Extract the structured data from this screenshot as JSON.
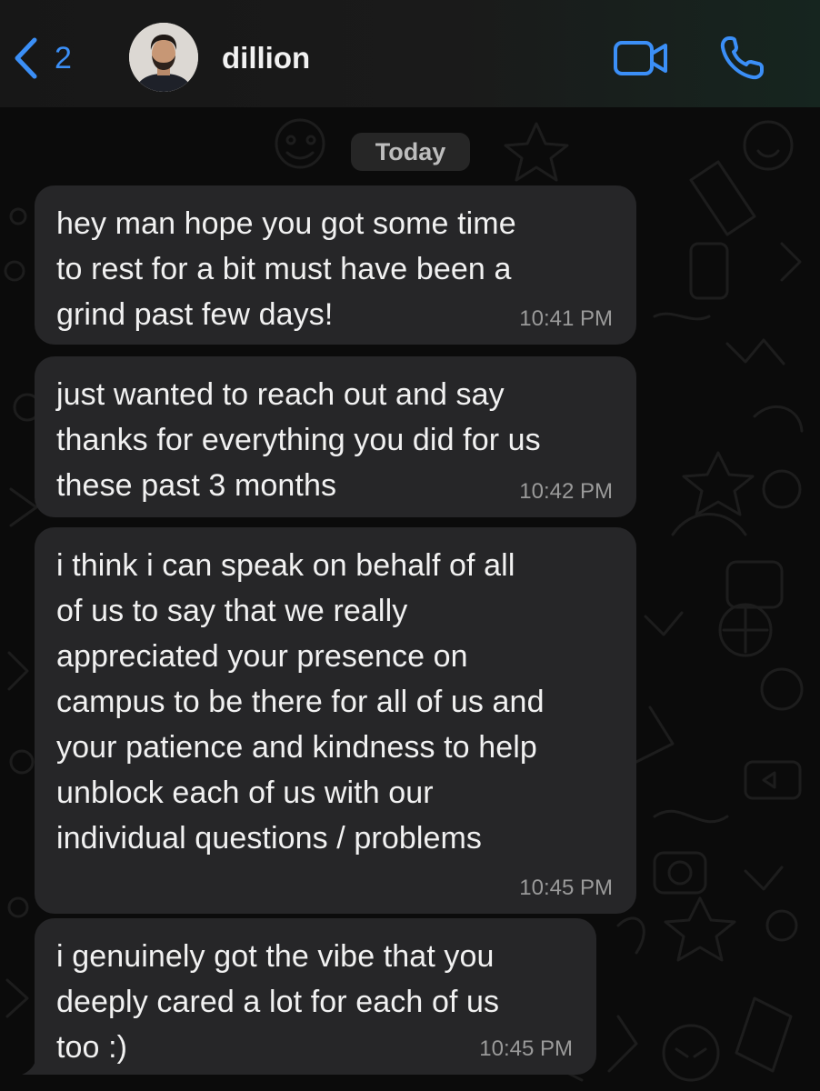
{
  "header": {
    "back_count": "2",
    "contact_name": "dillion",
    "accent_color": "#3b8ff7",
    "icons": [
      "chevron-left-icon",
      "video-camera-icon",
      "phone-icon"
    ]
  },
  "chat": {
    "date_label": "Today",
    "messages": [
      {
        "text": "hey man hope you got some time\nto rest for a bit must have been a\ngrind past few days!",
        "time": "10:41 PM"
      },
      {
        "text": "just wanted to reach out and say\nthanks for everything you did for us\nthese past 3 months",
        "time": "10:42 PM"
      },
      {
        "text": "i think i can speak on behalf of all\nof us to say that we really\nappreciated your presence on\ncampus to be there for all of us and\nyour patience and kindness to help\nunblock each of us with our\nindividual questions / problems",
        "time": "10:45 PM"
      },
      {
        "text": "i genuinely got the vibe that you\ndeeply cared a lot for each of us\ntoo :)",
        "time": "10:45 PM"
      }
    ]
  }
}
